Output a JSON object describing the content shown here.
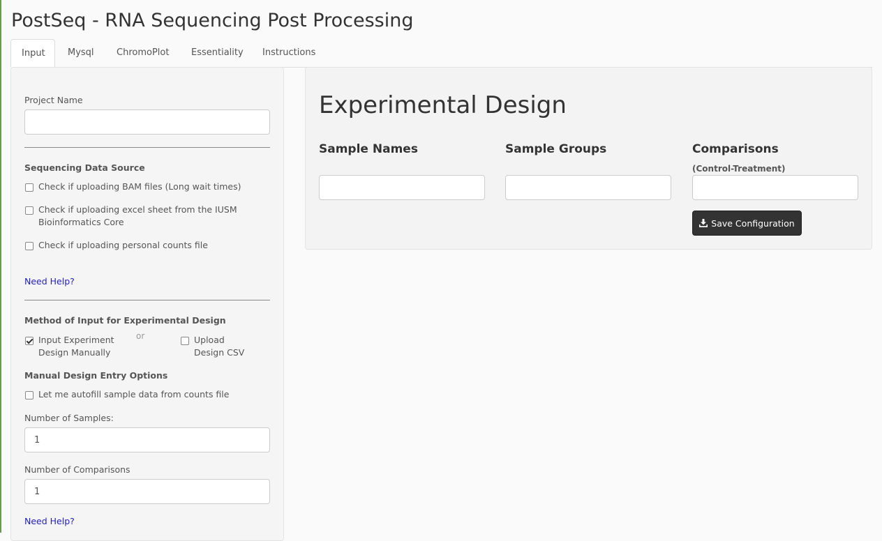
{
  "app": {
    "title": "PostSeq - RNA Sequencing Post Processing"
  },
  "tabs": [
    {
      "label": "Input",
      "active": true
    },
    {
      "label": "Mysql",
      "active": false
    },
    {
      "label": "ChromoPlot",
      "active": false
    },
    {
      "label": "Essentiality",
      "active": false
    },
    {
      "label": "Instructions",
      "active": false
    }
  ],
  "sidebar": {
    "project_name_label": "Project Name",
    "project_name_value": "",
    "data_source_heading": "Sequencing Data Source",
    "data_source_options": [
      {
        "label": "Check if uploading BAM files (Long wait times)",
        "checked": false
      },
      {
        "label": "Check if uploading excel sheet from the IUSM Bioinformatics Core",
        "checked": false
      },
      {
        "label": "Check if uploading personal counts file",
        "checked": false
      }
    ],
    "help_link_1": "Need Help?",
    "method_heading": "Method of Input for Experimental Design",
    "method_manual": {
      "label": "Input Experiment Design Manually",
      "checked": true
    },
    "method_or": "or",
    "method_csv": {
      "label": "Upload Design CSV",
      "checked": false
    },
    "manual_options_heading": "Manual Design Entry Options",
    "autofill": {
      "label": "Let me autofill sample data from counts file",
      "checked": false
    },
    "num_samples_label": "Number of Samples:",
    "num_samples_value": "1",
    "num_comparisons_label": "Number of Comparisons",
    "num_comparisons_value": "1",
    "help_link_2": "Need Help?"
  },
  "main": {
    "title": "Experimental Design",
    "columns": {
      "sample_names": "Sample Names",
      "sample_groups": "Sample Groups",
      "comparisons": "Comparisons",
      "comparisons_sub": "(Control-Treatment)"
    },
    "inputs": {
      "sample_name": "",
      "sample_group": "",
      "comparison": ""
    },
    "save_button": "Save Configuration"
  },
  "icons": {
    "save": "download-icon"
  },
  "colors": {
    "button_bg": "#333333",
    "link": "#2222cc",
    "accent_edge": "#6a9b52"
  }
}
